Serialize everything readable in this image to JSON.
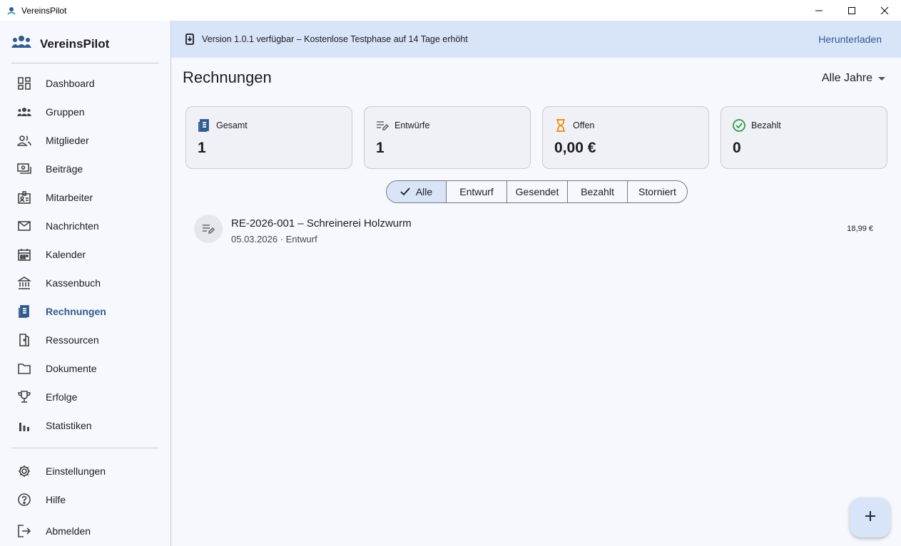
{
  "window": {
    "title": "VereinsPilot",
    "controls": [
      "minimize-icon",
      "maximize-icon",
      "close-icon"
    ]
  },
  "sidebar": {
    "brand": "VereinsPilot",
    "items": [
      {
        "label": "Dashboard",
        "icon": "dashboard-icon"
      },
      {
        "label": "Gruppen",
        "icon": "groups-icon"
      },
      {
        "label": "Mitglieder",
        "icon": "people-icon"
      },
      {
        "label": "Beiträge",
        "icon": "payments-icon"
      },
      {
        "label": "Mitarbeiter",
        "icon": "badge-icon"
      },
      {
        "label": "Nachrichten",
        "icon": "mail-icon"
      },
      {
        "label": "Kalender",
        "icon": "calendar-icon"
      },
      {
        "label": "Kassenbuch",
        "icon": "bank-icon"
      },
      {
        "label": "Rechnungen",
        "icon": "receipt-icon",
        "active": true
      },
      {
        "label": "Ressourcen",
        "icon": "door-icon"
      },
      {
        "label": "Dokumente",
        "icon": "folder-icon"
      },
      {
        "label": "Erfolge",
        "icon": "trophy-icon"
      },
      {
        "label": "Statistiken",
        "icon": "bar-chart-icon"
      }
    ],
    "bottom_items": [
      {
        "label": "Einstellungen",
        "icon": "gear-icon"
      },
      {
        "label": "Hilfe",
        "icon": "help-icon"
      },
      {
        "label": "Abmelden",
        "icon": "logout-icon"
      }
    ]
  },
  "banner": {
    "text": "Version 1.0.1 verfügbar – Kostenlose Testphase auf 14 Tage erhöht",
    "action": "Herunterladen"
  },
  "header": {
    "title": "Rechnungen",
    "year_filter": "Alle Jahre"
  },
  "stats": [
    {
      "label": "Gesamt",
      "value": "1",
      "icon": "receipt-icon",
      "color": "#2f5b8f"
    },
    {
      "label": "Entwürfe",
      "value": "1",
      "icon": "edit-note-icon",
      "color": "#6b6b72"
    },
    {
      "label": "Offen",
      "value": "0,00 €",
      "icon": "hourglass-icon",
      "color": "#f08c00"
    },
    {
      "label": "Bezahlt",
      "value": "0",
      "icon": "check-circle-icon",
      "color": "#2e9b4a"
    }
  ],
  "filters": {
    "options": [
      "Alle",
      "Entwurf",
      "Gesendet",
      "Bezahlt",
      "Storniert"
    ],
    "selected": "Alle"
  },
  "invoices": [
    {
      "title": "RE-2026-001 – Schreinerei Holzwurm",
      "subtitle": "05.03.2026 · Entwurf",
      "amount": "18,99 €",
      "icon": "edit-note-icon"
    }
  ],
  "fab": {
    "icon": "plus-icon"
  },
  "colors": {
    "accent": "#2f5b8f",
    "banner_bg": "#d8e4f8",
    "background": "#f7f8fd"
  }
}
